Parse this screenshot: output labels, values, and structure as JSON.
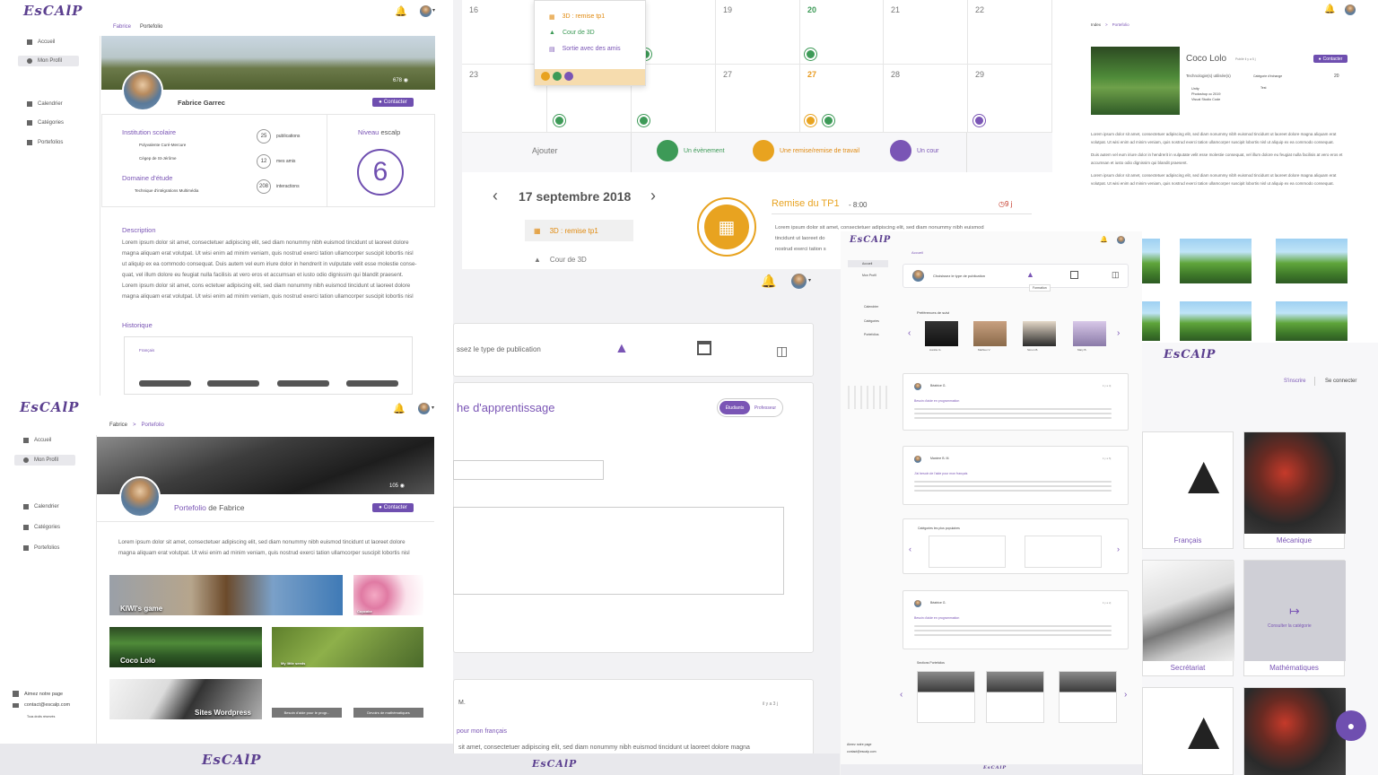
{
  "brand": "EsCAlP",
  "profile_top": {
    "breadcrumb": [
      "Fabrice",
      "Portefolio"
    ],
    "nav": [
      "Accueil",
      "Mon Profil",
      "Calendrier",
      "Catégories",
      "Portefolios"
    ],
    "name": "Fabrice Garrec",
    "views": "678",
    "contact_label": "Contacter",
    "institution_title": "Institution scolaire",
    "institutions": [
      "Polyvalente Curé-Mercure",
      "Cégep de St-Jérôme"
    ],
    "domain_title": "Domaine d'étude",
    "domain": "Technique d'intégrations Multimédia",
    "stats": [
      {
        "value": "25",
        "label": "publications"
      },
      {
        "value": "12",
        "label": "mes amis"
      },
      {
        "value": "208",
        "label": "interactions"
      }
    ],
    "level_label": "Niveau",
    "level_brand": "escalp",
    "level_value": "6",
    "description_title": "Description",
    "description_lines": [
      "Lorem ipsum dolor sit amet, consectetuer adipiscing elit, sed diam nonummy nibh euismod tincidunt ut laoreet dolore",
      "magna aliquam erat volutpat. Ut wisi enim ad minim veniam, quis nostrud exerci tation ullamcorper suscipit lobortis nisl",
      "ut aliquip ex ea commodo consequat. Duis autem vel eum iriure dolor in hendrerit in vulputate velit esse molestie conse-",
      "quat, vel illum dolore eu feugiat nulla facilisis at vero eros et accumsan et iusto odio dignissim qui blandit praesent.",
      "Lorem ipsum dolor sit amet, cons ectetuer adipiscing elit, sed diam nonummy nibh euismod tincidunt ut laoreet dolore",
      "magna aliquam erat volutpat. Ut wisi enim ad minim veniam, quis nostrud exerci tation ullamcorper suscipit lobortis nisl"
    ],
    "history_title": "Historique",
    "history_tag": "Français"
  },
  "portfolio": {
    "breadcrumb": [
      "Fabrice",
      "Portefolio"
    ],
    "nav": [
      "Accueil",
      "Mon Profil",
      "Calendrier",
      "Catégories",
      "Portefolios"
    ],
    "title_prefix": "Portefolio",
    "title_suffix": "de Fabrice",
    "views": "105",
    "contact_label": "Contacter",
    "intro_lines": [
      "Lorem ipsum dolor sit amet, consectetuer adipiscing elit, sed diam nonummy nibh euismod tincidunt ut laoreet dolore",
      "magna aliquam erat volutpat. Ut wisi enim ad minim veniam, quis nostrud exerci tation ullamcorper suscipit lobortis nisl"
    ],
    "tiles": [
      "KIWI's game",
      "Cupcake",
      "Coco Lolo",
      "My little seeds",
      "Sites Wordpress",
      "Besoin d'aide pour le progr...",
      "Devoirs de mathématiques"
    ],
    "footer": [
      "Aimez notre page",
      "contact@escalp.com"
    ],
    "footer_small": "Tous droits réservés"
  },
  "calendar": {
    "dropdown": [
      "3D : remise tp1",
      "Cour de 3D",
      "Sortie avec des amis"
    ],
    "row1": [
      "16",
      "19",
      "20",
      "21",
      "22"
    ],
    "row2": [
      "23",
      "27",
      "27",
      "28",
      "29"
    ],
    "add_label": "Ajouter",
    "add_options": [
      "Un évènement",
      "Une remise/remise de travail",
      "Un cour"
    ],
    "date": "17 septembre 2018",
    "events": [
      "3D : remise tp1",
      "Cour de 3D"
    ],
    "event_title": "Remise du TP1",
    "event_time": "8:00",
    "event_countdown": "9 j",
    "event_desc": [
      "Lorem ipsum dolor sit amet, consectetuer adipiscing elit, sed diam nonummy nibh euismod",
      "tincidunt ut laoreet do",
      "nostrud exerci tation s"
    ]
  },
  "publication": {
    "choose_label": "ssez le type de publication",
    "title": "he d'apprentissage",
    "toggle": [
      "Étudiants",
      "Professeur"
    ],
    "row_label": "M.",
    "row_meta": "il y a 3 j",
    "row_link": "pour mon français",
    "row_text": "sit amet, consectetuer adipiscing elit, sed diam nonummy nibh euismod tincidunt ut laoreet dolore magna"
  },
  "feed": {
    "breadcrumb": "Accueil",
    "nav": [
      "Accueil",
      "Mon Profil",
      "Calendrier",
      "Catégories",
      "Portefolios"
    ],
    "choose": "Choisissez le type de publication",
    "tooltip": "Formation",
    "friends_title": "Préférences de suivi",
    "friends": [
      "Aurélie G.",
      "Mathieu V.",
      "Simon B.",
      "Mary B."
    ],
    "posts": [
      {
        "author": "Béatrice G.",
        "date": "il y a 3j",
        "link": "Besoin d'aide en programmation"
      },
      {
        "author": "Maxime B. M.",
        "date": "il y a 5j",
        "link": "J'ai besoin de l'aide pour mon français"
      },
      {
        "author": "Béatrice G.",
        "date": "il y a 2j",
        "link": "Besoin d'aide en programmation"
      }
    ],
    "popular_title": "Catégories les plus populaires",
    "portfolios_title": "Sections Portefolios",
    "footer": [
      "Aimez notre page",
      "contact@escalp.com"
    ]
  },
  "detail": {
    "breadcrumb": [
      "Index",
      "Portefolio"
    ],
    "title": "Coco Lolo",
    "subtitle": "Publié il y a 5 j",
    "contact_label": "Contacter",
    "tech_title": "Technologie(s) utilisée(s)",
    "techs": [
      "Unity",
      "Photoshop cc 2019",
      "Visual Studio Code"
    ],
    "category_label": "Catégorie d'échange",
    "category_value": "Test",
    "count": "20",
    "paragraphs": [
      "Lorem ipsum dolor sit amet, consectetuer adipiscing elit, sed diam nonummy nibh euismod tincidunt ut laoreet dolore magna aliquam erat volutpat. Ut wisi enim ad minim veniam, quis nostrud exerci tation ullamcorper suscipit lobortis nisl ut aliquip ex ea commodo consequat.",
      "Duis autem vel eum iriure dolor in hendrerit in vulputate velit esse molestie consequat, vel illum dolore eu feugiat nulla facilisis at vero eros et accumsan et iusto odio dignissim qui blandit praesent.",
      "Lorem ipsum dolor sit amet, consectetuer adipiscing elit, sed diam nonummy nibh euismod tincidunt ut laoreet dolore magna aliquam erat volutpat. Ut wisi enim ad minim veniam, quis nostrud exerci tation ullamcorper suscipit lobortis nisl ut aliquip ex ea commodo consequat."
    ]
  },
  "categories": {
    "signup": "S'inscrire",
    "login": "Se connecter",
    "items": [
      "Français",
      "Mécanique",
      "Secrétariat",
      "Mathématiques"
    ],
    "consult": "Consulter la catégorie"
  }
}
